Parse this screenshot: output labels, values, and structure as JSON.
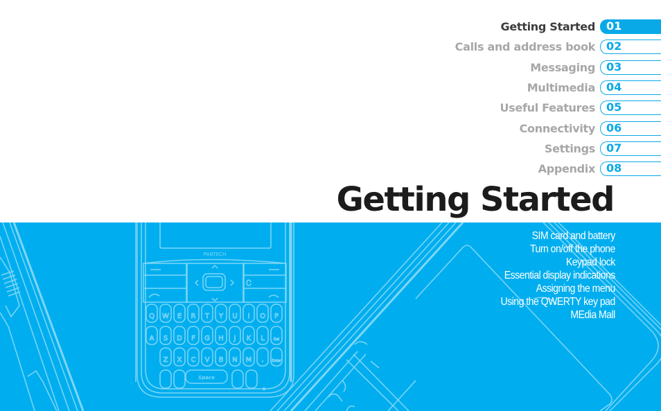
{
  "toc": {
    "items": [
      {
        "label": "Getting Started",
        "number": "01",
        "active": true
      },
      {
        "label": "Calls and address book",
        "number": "02",
        "active": false
      },
      {
        "label": "Messaging",
        "number": "03",
        "active": false
      },
      {
        "label": "Multimedia",
        "number": "04",
        "active": false
      },
      {
        "label": "Useful Features",
        "number": "05",
        "active": false
      },
      {
        "label": "Connectivity",
        "number": "06",
        "active": false
      },
      {
        "label": "Settings",
        "number": "07",
        "active": false
      },
      {
        "label": "Appendix",
        "number": "08",
        "active": false
      }
    ]
  },
  "chapter": {
    "title": "Getting Started",
    "sections": [
      "SIM card and battery",
      "Turn on/off the phone",
      "Keypad lock",
      "Essential display indications",
      "Assigning the menu",
      "Using the QWERTY key pad",
      "MEdia Mall"
    ]
  },
  "illustration": {
    "brand": "PANTECH",
    "space_key": "Space",
    "keys_row1": [
      "Q",
      "W",
      "E",
      "R",
      "T",
      "Y",
      "U",
      "I",
      "O",
      "P"
    ],
    "keys_row2": [
      "A",
      "S",
      "D",
      "F",
      "G",
      "H",
      "J",
      "K",
      "L",
      "Del"
    ],
    "keys_row3": [
      "Z",
      "X",
      "C",
      "V",
      "B",
      "N",
      "M",
      ".",
      "Enter"
    ]
  },
  "colors": {
    "accent": "#09a9e7",
    "banner": "#00aeef",
    "active_label": "#3c3c3c",
    "inactive_label": "#a7a7a7"
  }
}
